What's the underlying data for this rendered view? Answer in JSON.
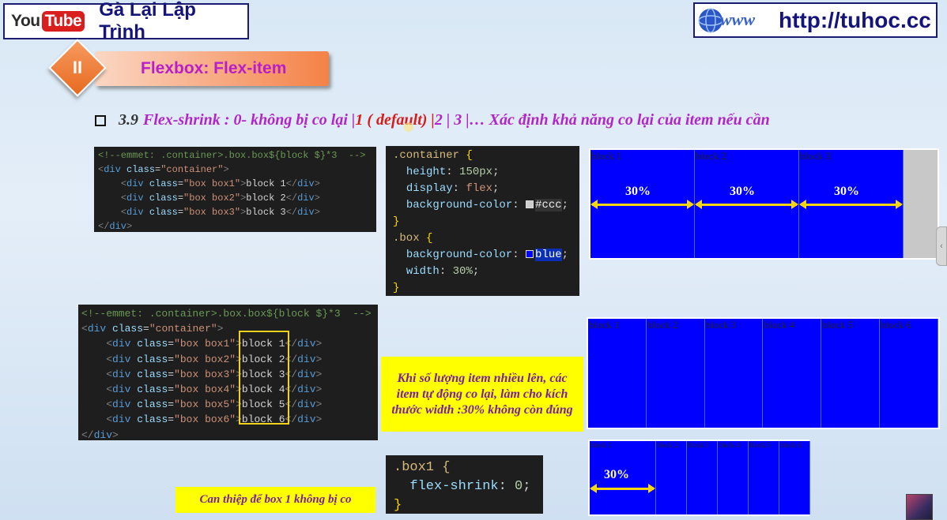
{
  "header": {
    "youtube_you": "You",
    "youtube_tube": "Tube",
    "channel_title": "Gà Lại Lập Trình",
    "url": "http://tuhoc.cc"
  },
  "section": {
    "number": "II",
    "title": "Flexbox: Flex-item"
  },
  "heading": {
    "number": "3.9",
    "part1": "Flex-shrink : 0- không bị co lại | ",
    "part2": "1 ( default) |",
    "part3": "  2 | 3 |…  Xác định khả năng co lại của item nếu cần"
  },
  "code_html_3": {
    "comment": "<!--emmet: .container>.box.box${block $}*3  -->",
    "container_open": [
      "<",
      "div",
      " ",
      "class",
      "=",
      "\"container\"",
      ">"
    ],
    "items": [
      {
        "cls": "\"box box1\"",
        "text": "block 1"
      },
      {
        "cls": "\"box box2\"",
        "text": "block 2"
      },
      {
        "cls": "\"box box3\"",
        "text": "block 3"
      }
    ],
    "container_close": "</div>"
  },
  "code_css": {
    "lines": [
      {
        "type": "sel",
        "text": ".container {"
      },
      {
        "type": "prop",
        "prop": "height",
        "val": "150px",
        "kind": "num"
      },
      {
        "type": "prop",
        "prop": "display",
        "val": "flex",
        "kind": "kw"
      },
      {
        "type": "prop",
        "prop": "background-color",
        "val": "#ccc",
        "kind": "color",
        "swatch": "#cccccc"
      },
      {
        "type": "close",
        "text": "}"
      },
      {
        "type": "sel",
        "text": ".box {"
      },
      {
        "type": "prop",
        "prop": "background-color",
        "val": "blue",
        "kind": "color",
        "swatch": "#0000ff"
      },
      {
        "type": "prop",
        "prop": "width",
        "val": "30%",
        "kind": "num"
      },
      {
        "type": "close",
        "text": "}"
      }
    ]
  },
  "code_html_6": {
    "comment": "<!--emmet: .container>.box.box${block $}*3  -->",
    "items": [
      {
        "cls": "\"box box1\"",
        "text": "block 1"
      },
      {
        "cls": "\"box box2\"",
        "text": "block 2"
      },
      {
        "cls": "\"box box3\"",
        "text": "block 3"
      },
      {
        "cls": "\"box box4\"",
        "text": "block 4"
      },
      {
        "cls": "\"box box5\"",
        "text": "block 5"
      },
      {
        "cls": "\"box box6\"",
        "text": "block 6"
      }
    ]
  },
  "code_box1": {
    "selector": ".box1 {",
    "prop": "flex-shrink",
    "val": "0",
    "close": "}"
  },
  "demo1": {
    "blocks": [
      "block 1",
      "block 2",
      "block 3"
    ],
    "percent": "30%"
  },
  "demo2": {
    "blocks": [
      "block 1",
      "block 2",
      "block 3",
      "block 4",
      "block 5",
      "block 6"
    ]
  },
  "demo3": {
    "blocks": [
      "block 1",
      "block 2",
      "block 3",
      "block 4",
      "block 5",
      "block 6"
    ],
    "percent": "30%"
  },
  "notes": {
    "many_items": "Khi số lượng item nhiều lên, các item tự động co lại, làm cho kích thước width :30% không còn đúng",
    "intervene": "Can thiệp để box 1 không bị co"
  },
  "colors": {
    "box_blue": "#0000fe",
    "container_gray": "#c8c8c8",
    "arrow_yellow": "#f5d60f",
    "note_yellow": "#ffff00",
    "title_purple": "#b026c8"
  }
}
